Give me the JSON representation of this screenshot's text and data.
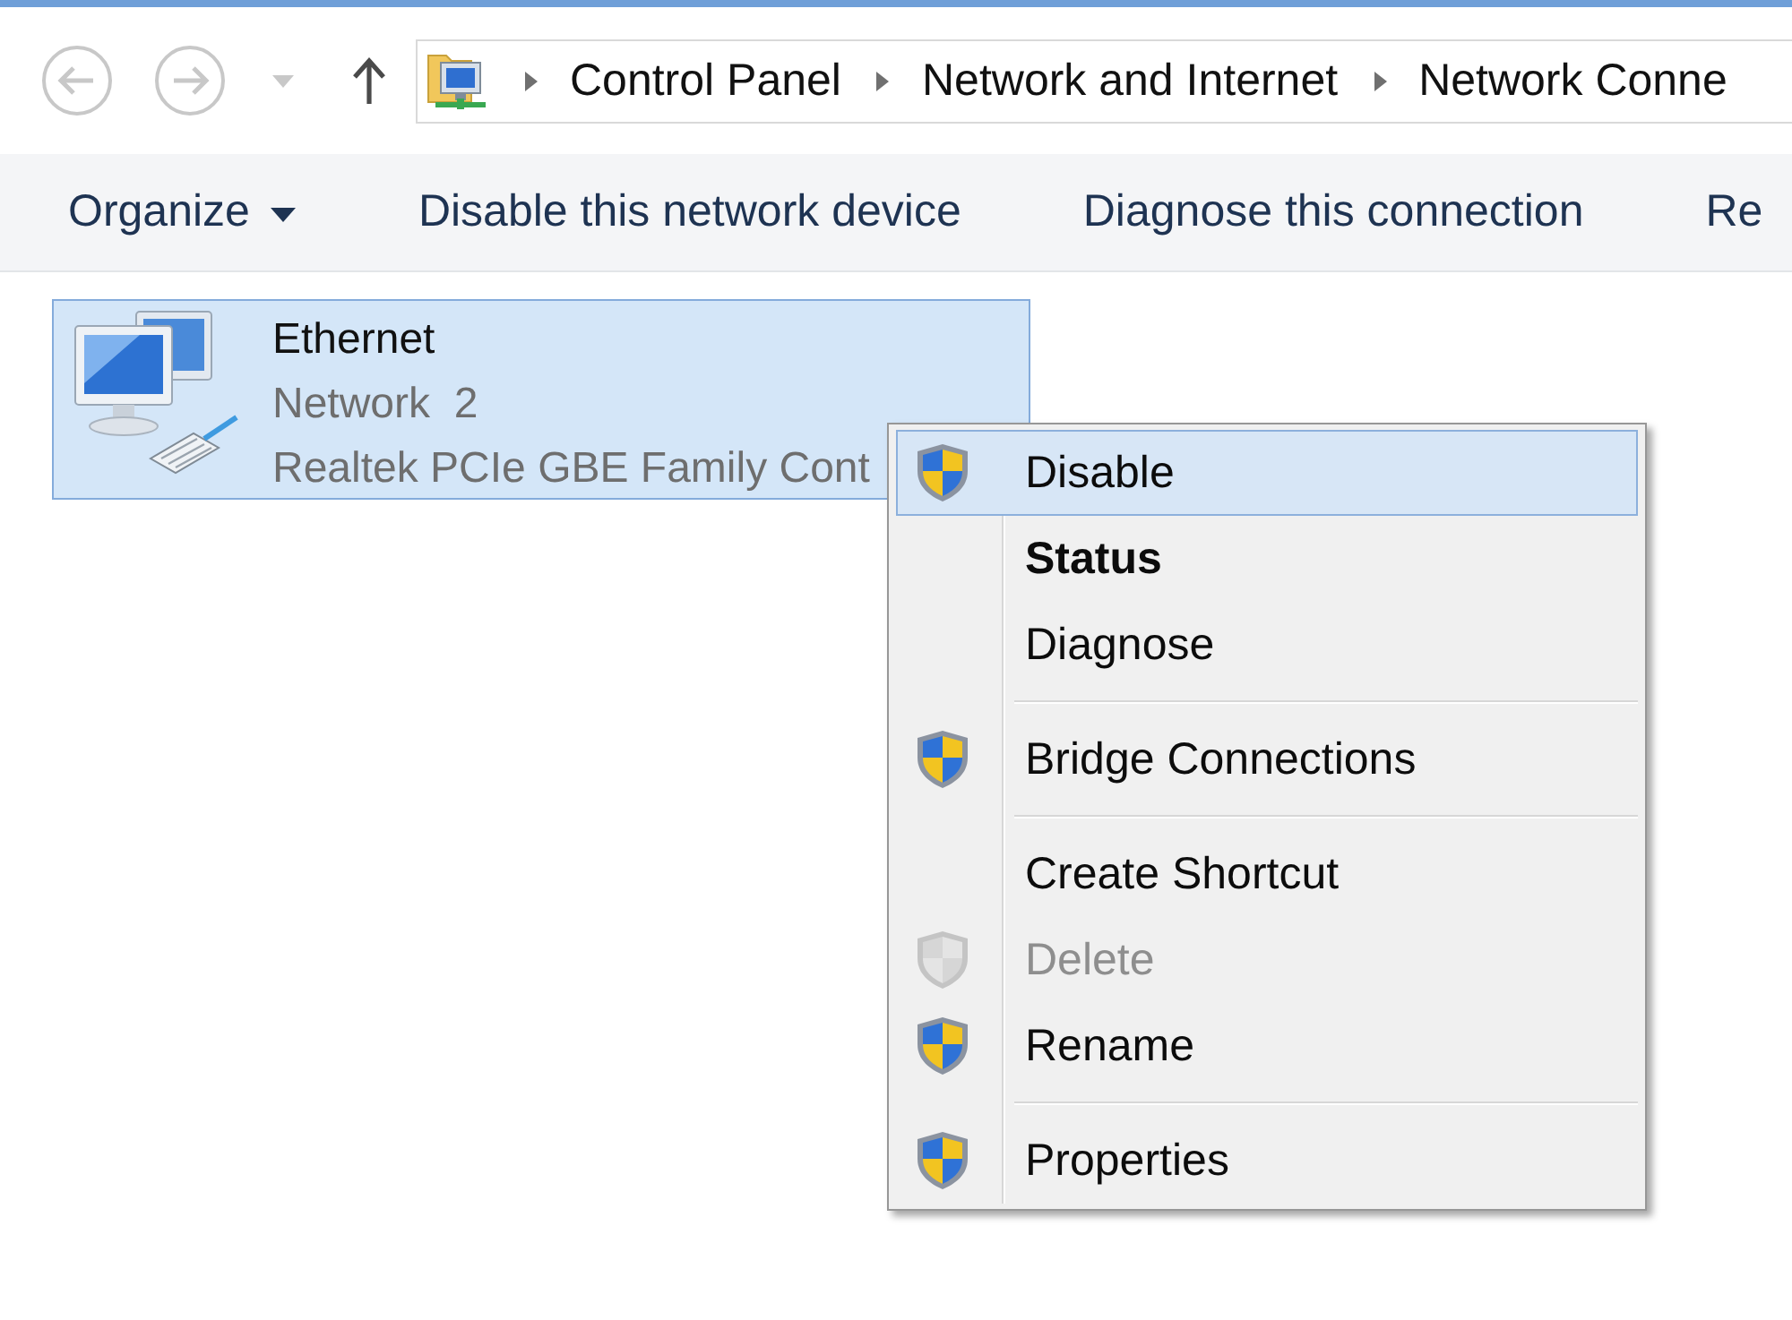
{
  "navigation": [
    {
      "kind": "back",
      "disabled": true
    },
    {
      "kind": "forward",
      "disabled": true
    },
    {
      "kind": "recent",
      "disabled": true
    },
    {
      "kind": "up",
      "disabled": false
    }
  ],
  "address_bar": {
    "breadcrumbs": [
      "Control Panel",
      "Network and Internet",
      "Network Conne"
    ]
  },
  "toolbar": [
    {
      "label": "Organize",
      "dropdown": true
    },
    {
      "label": "Disable this network device",
      "dropdown": false
    },
    {
      "label": "Diagnose this connection",
      "dropdown": false
    },
    {
      "label": "Re",
      "dropdown": false
    }
  ],
  "connections": [
    {
      "name": "Ethernet",
      "network": "Network  2",
      "adapter": "Realtek PCIe GBE Family Cont",
      "selected": true
    }
  ],
  "context_menu": {
    "groups": [
      {
        "items": [
          {
            "label": "Disable",
            "shield": true,
            "default": false,
            "disabled": false,
            "selected": true
          },
          {
            "label": "Status",
            "shield": false,
            "default": true,
            "disabled": false,
            "selected": false
          },
          {
            "label": "Diagnose",
            "shield": false,
            "default": false,
            "disabled": false,
            "selected": false
          }
        ]
      },
      {
        "items": [
          {
            "label": "Bridge Connections",
            "shield": true,
            "default": false,
            "disabled": false,
            "selected": false
          }
        ]
      },
      {
        "items": [
          {
            "label": "Create Shortcut",
            "shield": false,
            "default": false,
            "disabled": false,
            "selected": false
          },
          {
            "label": "Delete",
            "shield": true,
            "default": false,
            "disabled": true,
            "selected": false
          },
          {
            "label": "Rename",
            "shield": true,
            "default": false,
            "disabled": false,
            "selected": false
          }
        ]
      },
      {
        "items": [
          {
            "label": "Properties",
            "shield": true,
            "default": false,
            "disabled": false,
            "selected": false
          }
        ]
      }
    ]
  }
}
